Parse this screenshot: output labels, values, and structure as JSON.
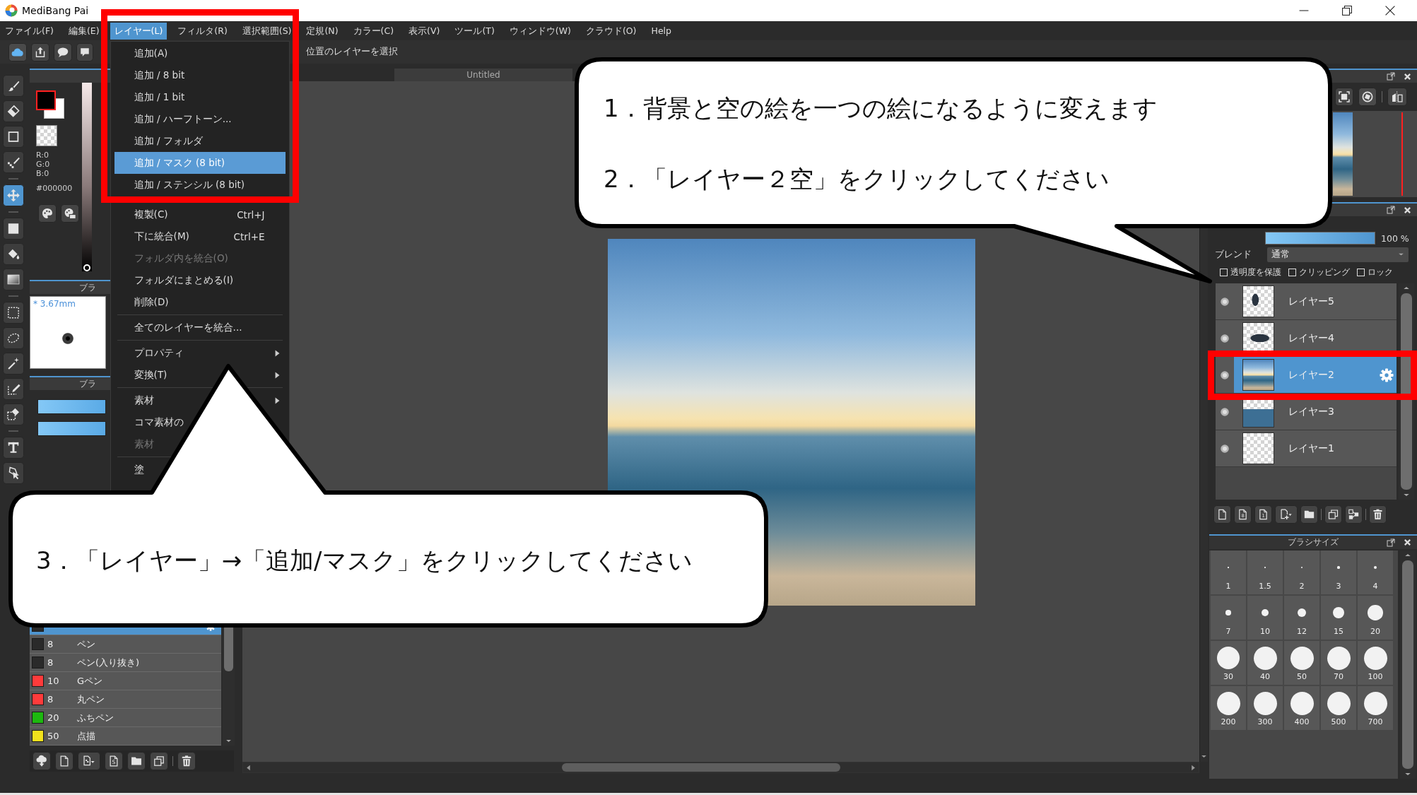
{
  "window": {
    "title": "MediBang Pai"
  },
  "menu_bar": [
    {
      "label": "ファイル(F)",
      "selected": false
    },
    {
      "label": "編集(E)",
      "selected": false
    },
    {
      "label": "レイヤー(L)",
      "selected": true
    },
    {
      "label": "フィルタ(R)",
      "selected": false
    },
    {
      "label": "選択範囲(S)",
      "selected": false
    },
    {
      "label": "定規(N)",
      "selected": false
    },
    {
      "label": "カラー(C)",
      "selected": false
    },
    {
      "label": "表示(V)",
      "selected": false
    },
    {
      "label": "ツール(T)",
      "selected": false
    },
    {
      "label": "ウィンドウ(W)",
      "selected": false
    },
    {
      "label": "クラウド(O)",
      "selected": false
    },
    {
      "label": "Help",
      "selected": false
    }
  ],
  "toolbar": {
    "hint": "位置のレイヤーを選択"
  },
  "tool_groups": [
    [
      {
        "selected": false
      },
      {
        "selected": false
      },
      {
        "selected": false
      },
      {
        "selected": false
      }
    ],
    [
      {
        "selected": true
      }
    ],
    [
      {
        "selected": false
      },
      {
        "selected": false
      },
      {
        "selected": false
      }
    ],
    [
      {
        "selected": false
      },
      {
        "selected": false
      },
      {
        "selected": false
      },
      {
        "selected": false
      },
      {
        "selected": false
      }
    ],
    [
      {
        "selected": false
      },
      {
        "selected": false
      }
    ]
  ],
  "color_panel": {
    "channels": [
      "R:0",
      "G:0",
      "B:0"
    ],
    "hex": "#000000",
    "brightness": {
      "level": 0
    }
  },
  "brush_preview": {
    "title": "ブラ",
    "size": "* 3.67mm"
  },
  "brush_panel": {
    "title": "ブラ",
    "sliders": [
      {
        "level": 1
      },
      {
        "level": 1
      }
    ]
  },
  "brush_list": [
    {
      "color": "#2a2a2a",
      "selected": true
    },
    {
      "color": "#2a2a2a",
      "size": "8",
      "name": "ペン",
      "selected": false
    },
    {
      "color": "#2a2a2a",
      "size": "8",
      "name": "ペン(入り抜き)",
      "selected": false
    },
    {
      "color": "#ff3b3b",
      "size": "10",
      "name": "Gペン",
      "selected": false
    },
    {
      "color": "#ff3b3b",
      "size": "8",
      "name": "丸ペン",
      "selected": false
    },
    {
      "color": "#1db80f",
      "size": "20",
      "name": "ふちペン",
      "selected": false
    },
    {
      "color": "#f2e21c",
      "size": "50",
      "name": "点描",
      "selected": false
    }
  ],
  "brush_toolbar": {
    "badge": "S"
  },
  "canvas": {
    "tab": "Untitled"
  },
  "layer_panel": {
    "opacity": {
      "level": 1,
      "reading": "100 %"
    },
    "blend": {
      "label": "ブレンド",
      "value": "通常"
    },
    "options": [
      {
        "label": "透明度を保護",
        "checked": false
      },
      {
        "label": "クリッピング",
        "checked": false
      },
      {
        "label": "ロック",
        "checked": false
      }
    ],
    "layers": [
      {
        "name": "レイヤー5",
        "visible": true,
        "selected": false
      },
      {
        "name": "レイヤー4",
        "visible": true,
        "selected": false
      },
      {
        "name": "レイヤー2",
        "visible": true,
        "selected": true
      },
      {
        "name": "レイヤー3",
        "visible": true,
        "selected": false
      },
      {
        "name": "レイヤー1",
        "visible": true,
        "selected": false
      }
    ],
    "bit_buttons": [
      "8",
      "1"
    ]
  },
  "brush_size_panel": {
    "title": "ブラシサイズ",
    "sizes": [
      "1",
      "1.5",
      "2",
      "3",
      "4",
      "7",
      "10",
      "12",
      "15",
      "20",
      "30",
      "40",
      "50",
      "70",
      "100",
      "200",
      "300",
      "400",
      "500",
      "700"
    ]
  },
  "layer_menu": {
    "items": [
      {
        "kind": "item",
        "label": "追加(A)",
        "selected": false,
        "disabled": false,
        "submenu": false
      },
      {
        "kind": "item",
        "label": "追加 / 8 bit",
        "selected": false,
        "disabled": false,
        "submenu": false
      },
      {
        "kind": "item",
        "label": "追加 / 1 bit",
        "selected": false,
        "disabled": false,
        "submenu": false
      },
      {
        "kind": "item",
        "label": "追加 / ハーフトーン...",
        "selected": false,
        "disabled": false,
        "submenu": false
      },
      {
        "kind": "item",
        "label": "追加 / フォルダ",
        "selected": false,
        "disabled": false,
        "submenu": false
      },
      {
        "kind": "item",
        "label": "追加 / マスク (8 bit)",
        "selected": true,
        "disabled": false,
        "submenu": false
      },
      {
        "kind": "item",
        "label": "追加 / ステンシル (8 bit)",
        "selected": false,
        "disabled": false,
        "submenu": false
      },
      {
        "kind": "separator"
      },
      {
        "kind": "item",
        "label": "複製(C)",
        "shortcut": "Ctrl+J",
        "selected": false,
        "disabled": false,
        "submenu": false
      },
      {
        "kind": "item",
        "label": "下に統合(M)",
        "shortcut": "Ctrl+E",
        "selected": false,
        "disabled": false,
        "submenu": false
      },
      {
        "kind": "item",
        "label": "フォルダ内を統合(O)",
        "selected": false,
        "disabled": true,
        "submenu": false
      },
      {
        "kind": "item",
        "label": "フォルダにまとめる(I)",
        "selected": false,
        "disabled": false,
        "submenu": false
      },
      {
        "kind": "item",
        "label": "削除(D)",
        "selected": false,
        "disabled": false,
        "submenu": false
      },
      {
        "kind": "separator"
      },
      {
        "kind": "item",
        "label": "全てのレイヤーを統合...",
        "selected": false,
        "disabled": false,
        "submenu": false
      },
      {
        "kind": "separator"
      },
      {
        "kind": "item",
        "label": "プロパティ",
        "selected": false,
        "disabled": false,
        "submenu": true
      },
      {
        "kind": "item",
        "label": "変換(T)",
        "selected": false,
        "disabled": false,
        "submenu": true
      },
      {
        "kind": "separator"
      },
      {
        "kind": "item",
        "label": "素材",
        "selected": false,
        "disabled": false,
        "submenu": true
      },
      {
        "kind": "item",
        "label": "コマ素材の",
        "selected": false,
        "disabled": false,
        "submenu": false
      },
      {
        "kind": "item",
        "label": "素材",
        "selected": false,
        "disabled": true,
        "submenu": false
      },
      {
        "kind": "separator"
      },
      {
        "kind": "item",
        "label": "塗",
        "selected": false,
        "disabled": false,
        "submenu": false
      }
    ]
  },
  "callouts": [
    {
      "lines": [
        "1．背景と空の絵を一つの絵になるように変えます",
        "2．「レイヤー２空」をクリックしてください"
      ]
    },
    {
      "lines": [
        "3．「レイヤー」→「追加/マスク」をクリックしてください"
      ]
    }
  ]
}
